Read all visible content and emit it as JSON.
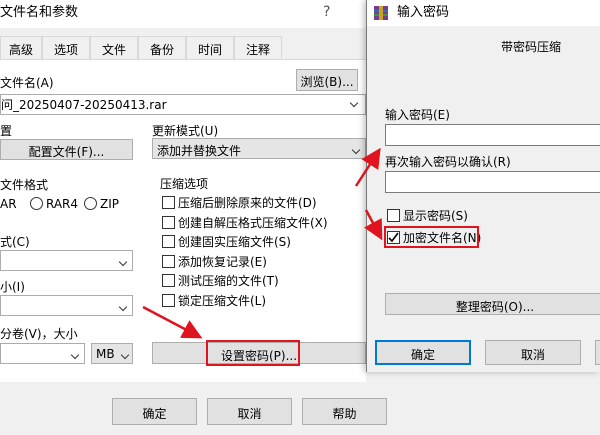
{
  "left_dialog": {
    "title": "文件名和参数",
    "help_glyph": "?",
    "tabs": [
      "高级",
      "选项",
      "文件",
      "备份",
      "时间",
      "注释"
    ],
    "archive_name_label": "文件名(A)",
    "browse_button": "浏览(B)...",
    "archive_name_value": "问_20250407-20250413.rar",
    "profile_label": "置",
    "profile_button": "配置文件(F)...",
    "update_mode_label": "更新模式(U)",
    "update_mode_value": "添加并替换文件",
    "format_label": "文件格式",
    "format_options": [
      "AR",
      "RAR4",
      "ZIP"
    ],
    "method_label": "式(C)",
    "size_label": "小(I)",
    "split_label": "分卷(V)，大小",
    "split_unit": "MB",
    "compression_options_label": "压缩选项",
    "compression_options": [
      "压缩后删除原来的文件(D)",
      "创建自解压格式压缩文件(X)",
      "创建固实压缩文件(S)",
      "添加恢复记录(E)",
      "测试压缩的文件(T)",
      "锁定压缩文件(L)"
    ],
    "set_password_button": "设置密码(P)...",
    "ok_button": "确定",
    "cancel_button": "取消",
    "help_button": "帮助"
  },
  "password_dialog": {
    "title": "输入密码",
    "subtitle": "带密码压缩",
    "password_label": "输入密码(E)",
    "confirm_label": "再次输入密码以确认(R)",
    "show_password_label": "显示密码(S)",
    "encrypt_names_label": "加密文件名(N)",
    "encrypt_names_checked": true,
    "organize_button": "整理密码(O)...",
    "ok_button": "确定",
    "cancel_button": "取消"
  },
  "colors": {
    "annotation_red": "#e0141e",
    "focus_blue": "#0078d7"
  }
}
